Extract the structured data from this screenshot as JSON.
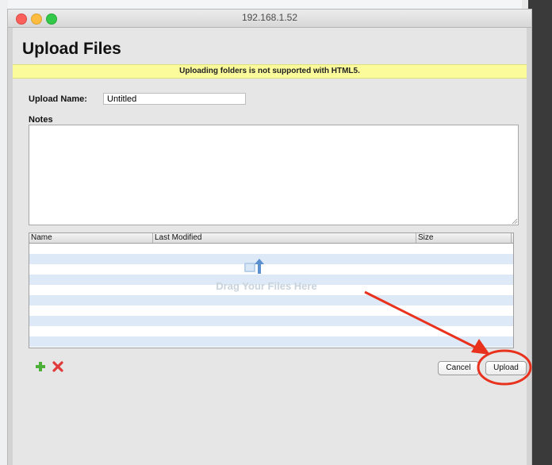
{
  "window": {
    "title": "192.168.1.52"
  },
  "page": {
    "heading": "Upload Files",
    "warning": "Uploading folders is not supported with HTML5."
  },
  "form": {
    "upload_name_label": "Upload Name:",
    "upload_name_value": "Untitled",
    "notes_label": "Notes",
    "notes_value": ""
  },
  "file_table": {
    "columns": [
      "Name",
      "Last Modified",
      "Size"
    ],
    "rows": [],
    "drop_hint": "Drag Your Files Here",
    "stripe_color": "#dde9f7"
  },
  "toolbar": {
    "add_icon": "green-plus-icon",
    "remove_icon": "red-x-icon",
    "cancel_label": "Cancel",
    "upload_label": "Upload"
  },
  "annotation": {
    "color": "#e8321e",
    "target": "Upload button"
  }
}
